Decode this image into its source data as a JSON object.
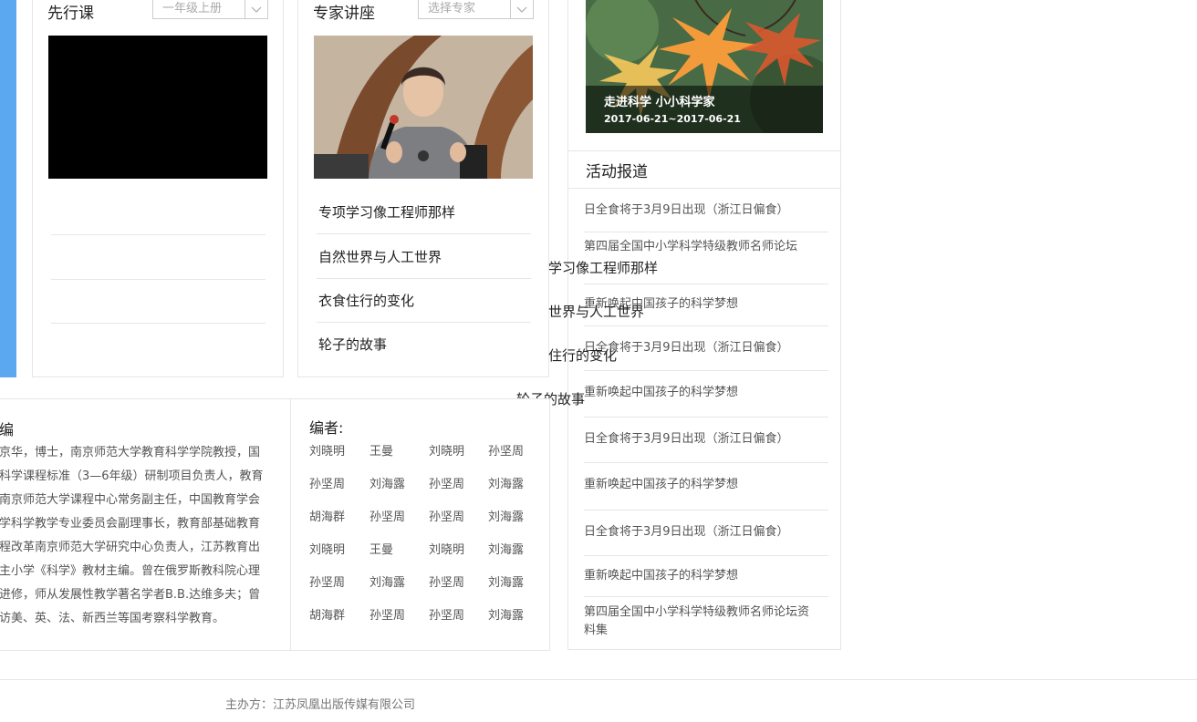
{
  "accent": "#5ba7f0",
  "preview": {
    "title": "先行课",
    "select_value": "一年级上册"
  },
  "lecture": {
    "title": "专家讲座",
    "select_placeholder": "选择专家",
    "items": [
      "专项学习像工程师那样",
      "自然世界与人工世界",
      "衣食住行的变化",
      "轮子的故事"
    ]
  },
  "overflow_items": [
    "学习像工程师那样",
    "世界与人工世界",
    "住行的变化",
    "轮子的故事"
  ],
  "event_banner": {
    "title": "走进科学 小小科学家",
    "date": "2017-06-21~2017-06-21"
  },
  "news": {
    "title": "活动报道",
    "items": [
      "日全食将于3月9日出现（浙江日偏食）",
      "第四届全国中小学科学特级教师名师论坛",
      "重新唤起中国孩子的科学梦想",
      "日全食将于3月9日出现（浙江日偏食）",
      "重新唤起中国孩子的科学梦想",
      "日全食将于3月9日出现（浙江日偏食）",
      "重新唤起中国孩子的科学梦想",
      "日全食将于3月9日出现（浙江日偏食）",
      "重新唤起中国孩子的科学梦想",
      "第四届全国中小学科学特级教师名师论坛资料集"
    ]
  },
  "chief_editor": {
    "title": "编",
    "lines": [
      "京华，博士，南京师范大学教育科学学院教授，国",
      "科学课程标准（3—6年级）研制项目负责人，教育",
      "南京师范大学课程中心常务副主任，中国教育学会",
      "学科学教学专业委员会副理事长，教育部基础教育",
      "程改革南京师范大学研究中心负责人，江苏教育出",
      "主小学《科学》教材主编。曾在俄罗斯教科院心理",
      "进修，师从发展性教学著名学者B.B.达维多夫；曾",
      "访美、英、法、新西兰等国考察科学教育。"
    ]
  },
  "editors": {
    "title": "编者:",
    "rows": [
      [
        "刘晓明",
        "王曼",
        "刘晓明",
        "孙坚周"
      ],
      [
        "孙坚周",
        "刘海露",
        "孙坚周",
        "刘海露"
      ],
      [
        "胡海群",
        "孙坚周",
        "孙坚周",
        "刘海露"
      ],
      [
        "刘晓明",
        "王曼",
        "刘晓明",
        "刘海露"
      ],
      [
        "孙坚周",
        "刘海露",
        "孙坚周",
        "刘海露"
      ],
      [
        "胡海群",
        "孙坚周",
        "孙坚周",
        "刘海露"
      ]
    ]
  },
  "footer": {
    "sponsor": "主办方：江苏凤凰出版传媒有限公司"
  }
}
